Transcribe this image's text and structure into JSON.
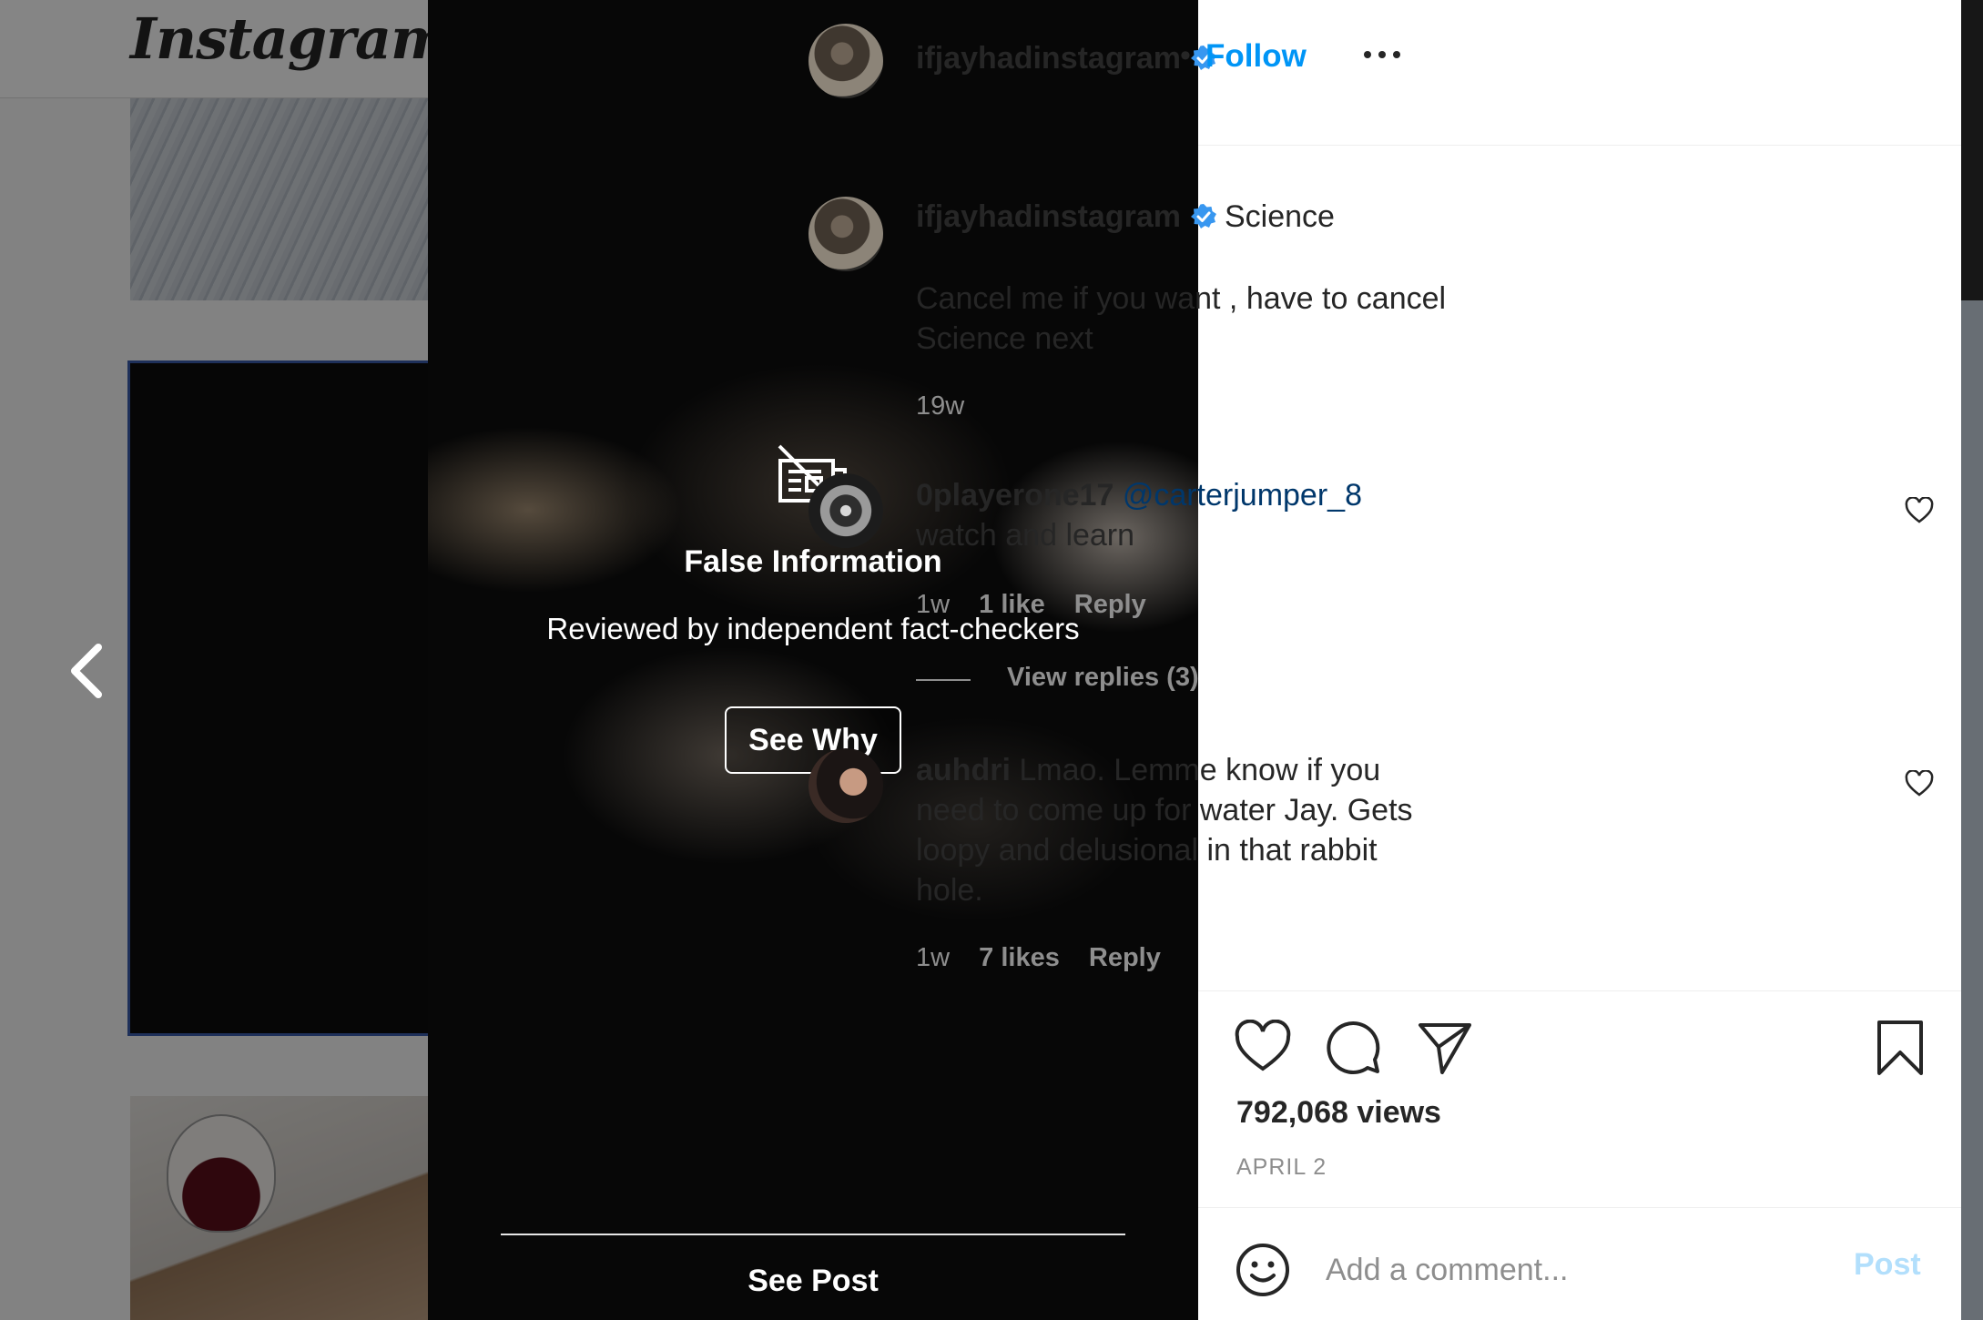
{
  "feed": {
    "logo": "Instagram"
  },
  "fact_check": {
    "title": "False Information",
    "subtitle": "Reviewed by independent fact-checkers",
    "see_why_label": "See Why",
    "see_post_label": "See Post"
  },
  "header": {
    "username": "ifjayhadinstagram",
    "separator": "•",
    "follow_label": "Follow"
  },
  "caption": {
    "username": "ifjayhadinstagram",
    "tag": "Science",
    "text": "Cancel me if you want , have to cancel Science next",
    "time": "19w"
  },
  "comments": [
    {
      "username": "0playerone17",
      "mention": "@carterjumper_8",
      "text": "watch and learn",
      "time": "1w",
      "likes": "1 like",
      "reply_label": "Reply",
      "view_replies": "View replies (3)"
    },
    {
      "username": "auhdri",
      "text": "Lmao. Lemme know if you need to come up for water Jay. Gets loopy and delusional in that rabbit hole.",
      "time": "1w",
      "likes": "7 likes",
      "reply_label": "Reply"
    }
  ],
  "actions": {
    "views": "792,068 views",
    "date": "APRIL 2"
  },
  "comment_box": {
    "placeholder": "Add a comment...",
    "post_label": "Post"
  },
  "colors": {
    "link_blue": "#0095f6",
    "mention_blue": "#00376b",
    "muted": "#8e8e8e",
    "post_disabled": "#b2dffc",
    "verified": "#3897f0"
  },
  "icons": [
    "chevron-left-icon",
    "news-off-icon",
    "verified-badge-icon",
    "more-icon",
    "heart-icon",
    "comment-icon",
    "share-icon",
    "bookmark-icon",
    "emoji-icon"
  ]
}
